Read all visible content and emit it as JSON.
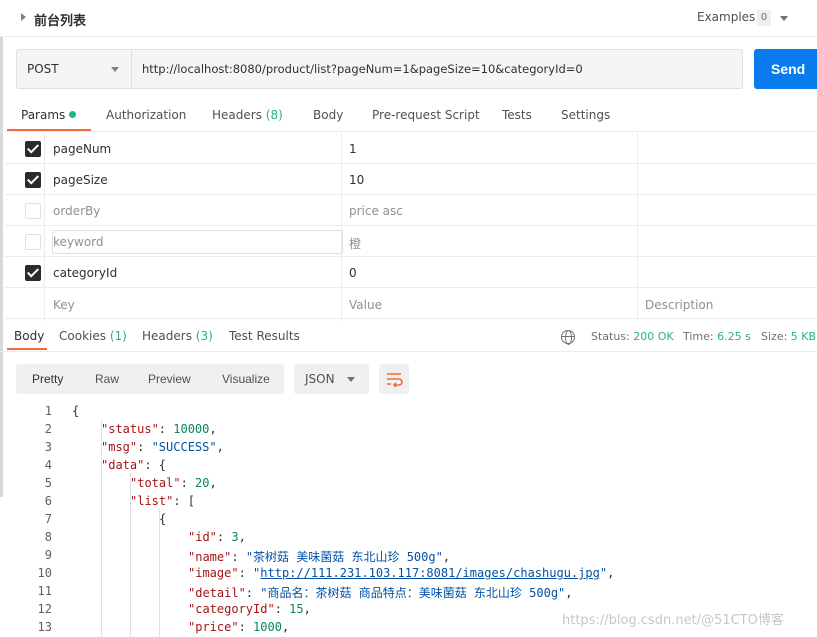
{
  "collection": {
    "title": "前台列表",
    "examples_label": "Examples",
    "examples_count": "0"
  },
  "request": {
    "method": "POST",
    "url": "http://localhost:8080/product/list?pageNum=1&pageSize=10&categoryId=0",
    "send_label": "Send"
  },
  "request_tabs": [
    {
      "label": "Params",
      "count": ""
    },
    {
      "label": "Authorization",
      "count": ""
    },
    {
      "label": "Headers",
      "count": "(8)"
    },
    {
      "label": "Body",
      "count": ""
    },
    {
      "label": "Pre-request Script",
      "count": ""
    },
    {
      "label": "Tests",
      "count": ""
    },
    {
      "label": "Settings",
      "count": ""
    }
  ],
  "params": [
    {
      "checked": true,
      "key": "pageNum",
      "value": "1"
    },
    {
      "checked": true,
      "key": "pageSize",
      "value": "10"
    },
    {
      "checked": false,
      "key": "orderBy",
      "value": "price asc"
    },
    {
      "checked": false,
      "key": "keyword",
      "value": "橙"
    },
    {
      "checked": true,
      "key": "categoryId",
      "value": "0"
    }
  ],
  "param_placeholders": {
    "key": "Key",
    "value": "Value",
    "description": "Description"
  },
  "response_tabs": [
    {
      "label": "Body",
      "count": ""
    },
    {
      "label": "Cookies",
      "count": "(1)"
    },
    {
      "label": "Headers",
      "count": "(3)"
    },
    {
      "label": "Test Results",
      "count": ""
    }
  ],
  "response_status": {
    "status_label": "Status:",
    "status_value": "200 OK",
    "time_label": "Time:",
    "time_value": "6.25 s",
    "size_label": "Size:",
    "size_value": "5 KB"
  },
  "view_modes": [
    "Pretty",
    "Raw",
    "Preview",
    "Visualize"
  ],
  "format": "JSON",
  "code_lines": {
    "numbers": [
      "1",
      "2",
      "3",
      "4",
      "5",
      "6",
      "7",
      "8",
      "9",
      "10",
      "11",
      "12",
      "13"
    ],
    "l1": "{",
    "l2_key": "\"status\"",
    "l2_val": "10000",
    "l3_key": "\"msg\"",
    "l3_val": "\"SUCCESS\"",
    "l4_key": "\"data\"",
    "l4_rest": ": {",
    "l5_key": "\"total\"",
    "l5_val": "20",
    "l6_key": "\"list\"",
    "l6_rest": ": [",
    "l7": "{",
    "l8_key": "\"id\"",
    "l8_val": "3",
    "l9_key": "\"name\"",
    "l9_val": "\"茶树菇 美味菌菇 东北山珍 500g\"",
    "l10_key": "\"image\"",
    "l10_val": "http://111.231.103.117:8081/images/chashugu.jpg",
    "l11_key": "\"detail\"",
    "l11_val": "\"商品名：茶树菇 商品特点：美味菌菇 东北山珍 500g\"",
    "l12_key": "\"categoryId\"",
    "l12_val": "15",
    "l13_key": "\"price\"",
    "l13_val": "1000"
  },
  "watermark": "https://blog.csdn.net/@51CTO博客"
}
